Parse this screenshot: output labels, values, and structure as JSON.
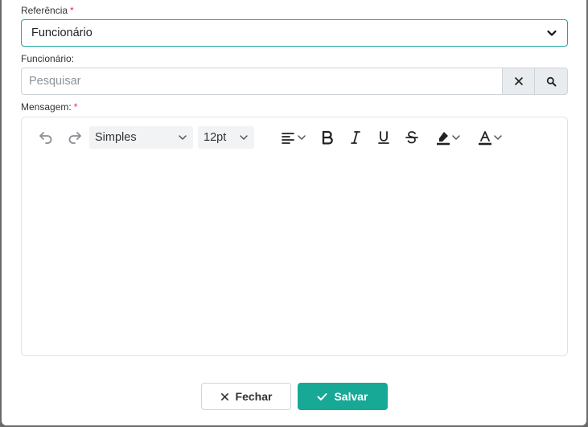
{
  "form": {
    "referencia": {
      "label": "Referência",
      "required_mark": "*",
      "value": "Funcionário",
      "chevron_icon": "chevron-down-icon"
    },
    "funcionario": {
      "label": "Funcionário:",
      "placeholder": "Pesquisar",
      "clear_icon": "close-icon",
      "search_icon": "search-icon"
    },
    "mensagem": {
      "label": "Mensagem:",
      "required_mark": "*",
      "toolbar": {
        "undo_icon": "undo-icon",
        "redo_icon": "redo-icon",
        "block_format": "Simples",
        "font_size": "12pt",
        "align_icon": "align-left-icon",
        "bold_icon": "bold-icon",
        "italic_icon": "italic-icon",
        "underline_icon": "underline-icon",
        "strike_icon": "strikethrough-icon",
        "highlight_icon": "highlight-color-icon",
        "text_color_icon": "text-color-icon"
      },
      "body": ""
    }
  },
  "footer": {
    "close_label": "Fechar",
    "save_label": "Salvar"
  },
  "colors": {
    "accent": "#17a896",
    "focus_border": "#20a99a",
    "required": "#dc3545"
  }
}
